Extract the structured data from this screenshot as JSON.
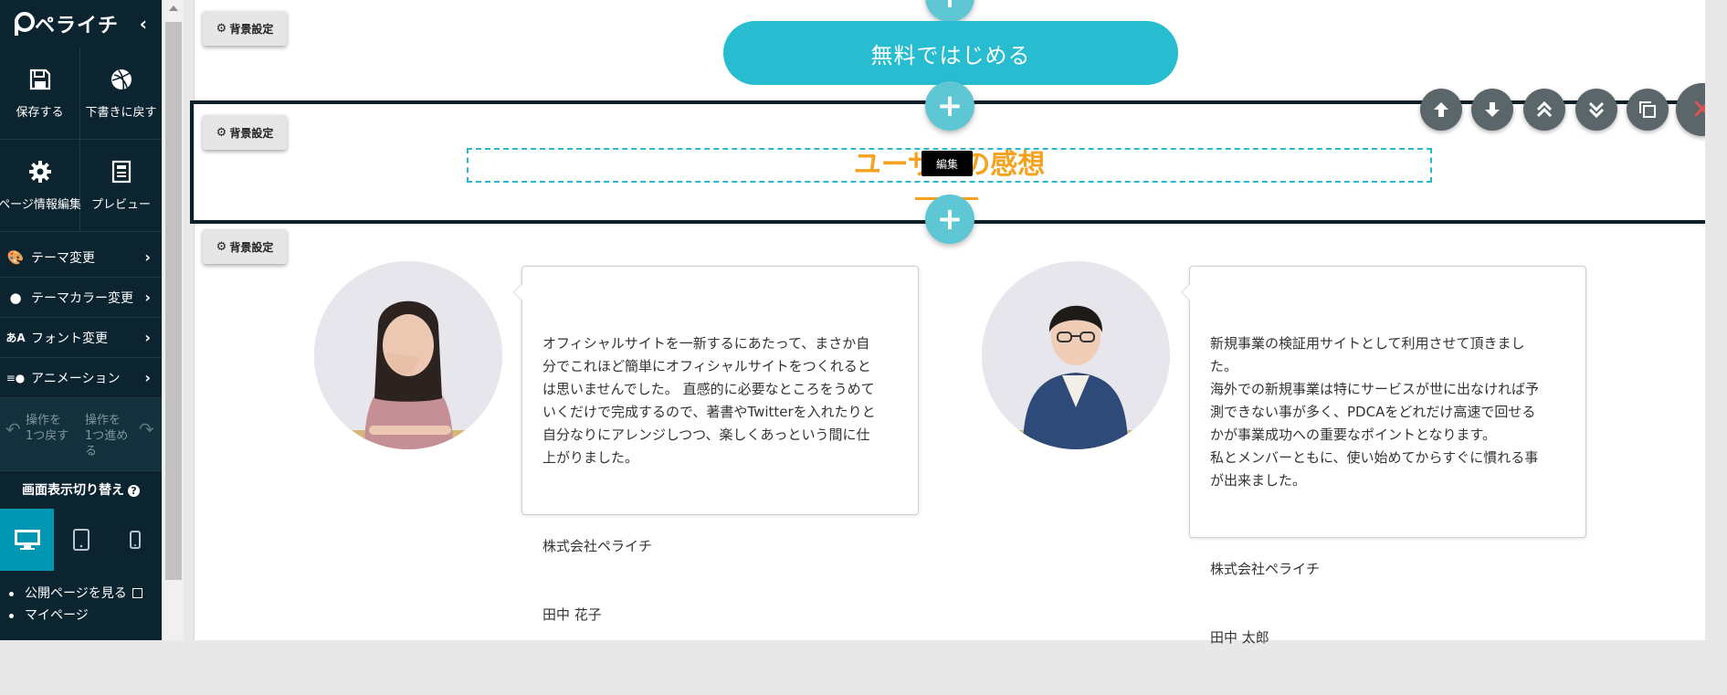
{
  "brand": {
    "name": "ペライチ",
    "collapse_icon": "chevron-left-icon"
  },
  "tiles": [
    {
      "label": "保存する",
      "icon": "save-icon"
    },
    {
      "label": "下書きに戻す",
      "icon": "dribbble-icon"
    },
    {
      "label": "ページ情報編集",
      "icon": "gear-icon"
    },
    {
      "label": "プレビュー",
      "icon": "preview-icon"
    }
  ],
  "menu": [
    {
      "label": "テーマ変更",
      "icon": "palette-icon"
    },
    {
      "label": "テーマカラー変更",
      "icon": "color-palette-icon"
    },
    {
      "label": "フォント変更",
      "icon": "font-icon"
    },
    {
      "label": "アニメーション",
      "icon": "animation-icon"
    }
  ],
  "history": {
    "undo": "操作を\n1つ戻す",
    "redo": "操作を\n1つ進め\nる"
  },
  "view_switch": {
    "title": "画面表示切り替え",
    "active": "desktop"
  },
  "links": [
    {
      "label": "公開ページを見る"
    },
    {
      "label": "マイページ"
    }
  ],
  "editor": {
    "background_settings": "背景設定",
    "cta_label": "無料ではじめる",
    "heading": "ユーザーの感想",
    "edit_tooltip": "編集"
  },
  "testimonials": [
    {
      "text": "オフィシャルサイトを一新するにあたって、まさか自\n分でこれほど簡単にオフィシャルサイトをつくれると\nは思いませんでした。 直感的に必要なところをうめて\nいくだけで完成するので、著書やTwitterを入れたりと\n自分なりにアレンジしつつ、楽しくあっという間に仕\n上がりました。",
      "company": "株式会社ペライチ",
      "name": "田中 花子"
    },
    {
      "text": "新規事業の検証用サイトとして利用させて頂きまし\nた。\n海外での新規事業は特にサービスが世に出なければ予\n測できない事が多く、PDCAをどれだけ高速で回せる\nかが事業成功への重要なポイントとなります。\n私とメンバーともに、使い始めてからすぐに慣れる事\nが出来ました。",
      "company": "株式会社ペライチ",
      "name": "田中 太郎"
    }
  ],
  "colors": {
    "sidebar": "#0b2430",
    "accent": "#28bcd1",
    "heading": "#f5a21e",
    "delete": "#e0514f"
  }
}
